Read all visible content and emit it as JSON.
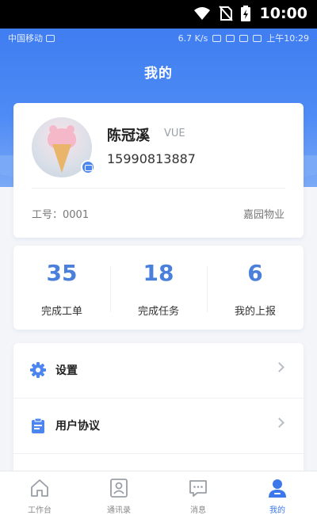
{
  "system_bar": {
    "time": "10:00"
  },
  "status_bar": {
    "carrier": "中国移动",
    "speed": "6.7 K/s",
    "time": "上午10:29"
  },
  "header": {
    "title": "我的"
  },
  "profile": {
    "name": "陈冠溪",
    "tag": "VUE",
    "phone": "15990813887",
    "job_no": "工号：0001",
    "company": "嘉园物业"
  },
  "stats": [
    {
      "value": "35",
      "label": "完成工单"
    },
    {
      "value": "18",
      "label": "完成任务"
    },
    {
      "value": "6",
      "label": "我的上报"
    }
  ],
  "menu": [
    {
      "label": "设置",
      "icon": "gear-icon"
    },
    {
      "label": "用户协议",
      "icon": "clipboard-icon"
    }
  ],
  "tabs": [
    {
      "label": "工作台",
      "icon": "home-icon",
      "active": false
    },
    {
      "label": "通讯录",
      "icon": "contacts-icon",
      "active": false
    },
    {
      "label": "消息",
      "icon": "message-icon",
      "active": false
    },
    {
      "label": "我的",
      "icon": "user-icon",
      "active": true
    }
  ],
  "colors": {
    "accent": "#4a7fdc",
    "hero": "#3f7df1",
    "active_tab": "#3d78ea"
  }
}
